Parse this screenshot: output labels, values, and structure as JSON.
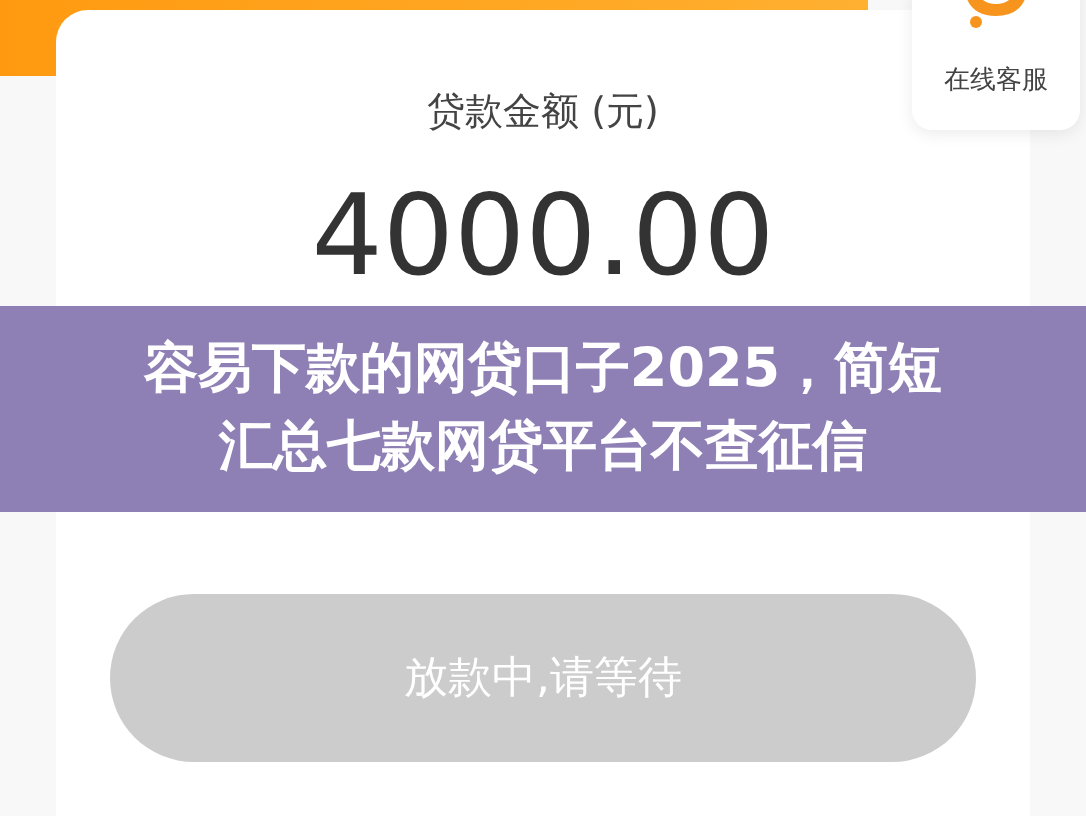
{
  "customer_service": {
    "label": "在线客服"
  },
  "loan": {
    "label": "贷款金额 (元)",
    "amount": "4000.00"
  },
  "button": {
    "label": "放款中,请等待",
    "disabled": true
  },
  "banner": {
    "lines": [
      "容易下款的网贷口子2025，简短",
      "汇总七款网贷平台不查征信"
    ]
  }
}
